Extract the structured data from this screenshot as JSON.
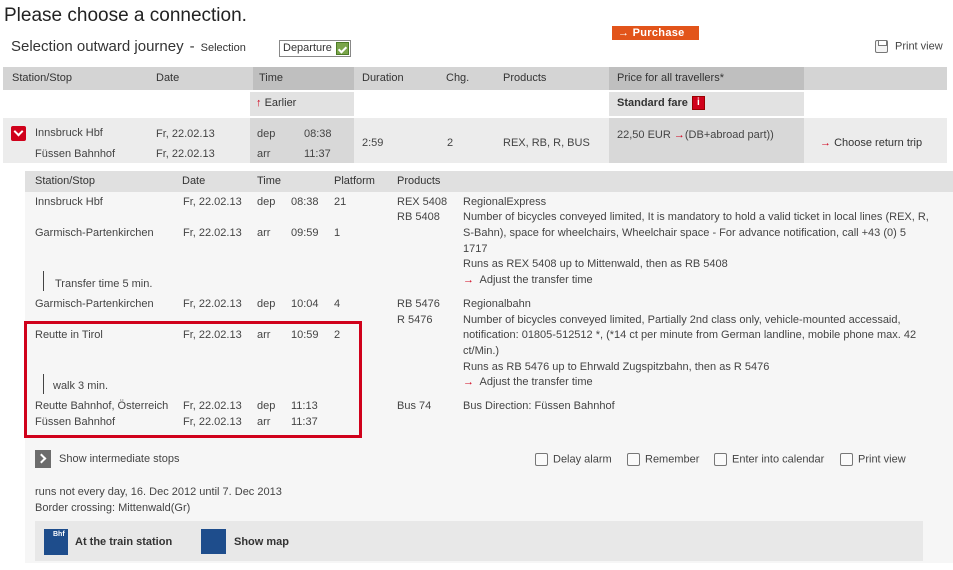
{
  "page_title": "Please choose a connection.",
  "section": {
    "title": "Selection outward journey",
    "dash": "-",
    "selection_label": "Selection",
    "selected_option": "Departure",
    "print_view": "Print view"
  },
  "table_header": {
    "station": "Station/Stop",
    "date": "Date",
    "time": "Time",
    "duration": "Duration",
    "changes": "Chg.",
    "products": "Products",
    "price": "Price for all travellers*"
  },
  "earlier": "Earlier",
  "standard_fare": "Standard fare",
  "info_icon": "i",
  "connection": {
    "from_station": "Innsbruck Hbf",
    "to_station": "Füssen Bahnhof",
    "dep_date": "Fr, 22.02.13",
    "arr_date": "Fr, 22.02.13",
    "dep_label": "dep",
    "arr_label": "arr",
    "dep_time": "08:38",
    "arr_time": "11:37",
    "duration": "2:59",
    "changes": "2",
    "products": "REX, RB, R, BUS",
    "price": "22,50 EUR",
    "price_note": "(DB+abroad part))",
    "purchase": "Purchase",
    "choose_return": "Choose return trip"
  },
  "detail_header": {
    "station": "Station/Stop",
    "date": "Date",
    "time": "Time",
    "platform": "Platform",
    "products": "Products"
  },
  "legs": {
    "l1_from": "Innsbruck Hbf",
    "l1_from_date": "Fr, 22.02.13",
    "l1_from_type": "dep",
    "l1_from_time": "08:38",
    "l1_from_platform": "21",
    "l1_product_a": "REX 5408",
    "l1_product_b": "RB 5408",
    "l1_name": "RegionalExpress",
    "l1_info_1": "Number of bicycles conveyed limited, It is mandatory to hold a valid ticket in local lines (REX, R,",
    "l1_info_2": "S-Bahn), space for wheelchairs, Wheelchair space - For advance notification, call +43 (0) 5",
    "l1_info_3": "1717",
    "l1_runs": "Runs as REX 5408 up to Mittenwald, then as RB 5408",
    "l1_adjust": "Adjust the transfer time",
    "l1_to": "Garmisch-Partenkirchen",
    "l1_to_date": "Fr, 22.02.13",
    "l1_to_type": "arr",
    "l1_to_time": "09:59",
    "l1_to_platform": "1",
    "transfer_1": "Transfer time 5 min.",
    "l2_from": "Garmisch-Partenkirchen",
    "l2_from_date": "Fr, 22.02.13",
    "l2_from_type": "dep",
    "l2_from_time": "10:04",
    "l2_from_platform": "4",
    "l2_product_a": "RB 5476",
    "l2_product_b": "R 5476",
    "l2_name": "Regionalbahn",
    "l2_info_1": "Number of bicycles conveyed limited, Partially 2nd class only, vehicle-mounted accessaid,",
    "l2_info_2": "notification: 01805-512512 *, (*14 ct per minute from German landline, mobile phone max. 42",
    "l2_info_3": "ct/Min.)",
    "l2_runs": "Runs as RB 5476 up to Ehrwald Zugspitzbahn, then as R 5476",
    "l2_adjust": "Adjust the transfer time",
    "l2_to": "Reutte in Tirol",
    "l2_to_date": "Fr, 22.02.13",
    "l2_to_type": "arr",
    "l2_to_time": "10:59",
    "l2_to_platform": "2",
    "walk": "walk  3 min.",
    "l3_from": "Reutte Bahnhof, Österreich",
    "l3_from_date": "Fr, 22.02.13",
    "l3_from_type": "dep",
    "l3_from_time": "11:13",
    "l3_product": "Bus 74",
    "l3_info": "Bus Direction: Füssen Bahnhof",
    "l3_to": "Füssen Bahnhof",
    "l3_to_date": "Fr, 22.02.13",
    "l3_to_type": "arr",
    "l3_to_time": "11:37"
  },
  "actions": {
    "intermediate": "Show intermediate stops",
    "delay_alarm": "Delay alarm",
    "remember": "Remember",
    "calendar": "Enter into calendar",
    "print_view": "Print view"
  },
  "notes": {
    "runs": "runs not every day, 16. Dec 2012 until 7. Dec 2013",
    "border": "Border crossing: Mittenwald(Gr)"
  },
  "bottom": {
    "station": "At the train station",
    "map": "Show map"
  },
  "colors": {
    "accent_red": "#d0011b",
    "purchase_orange": "#e2541a",
    "header_gray": "#d4d4d4"
  }
}
